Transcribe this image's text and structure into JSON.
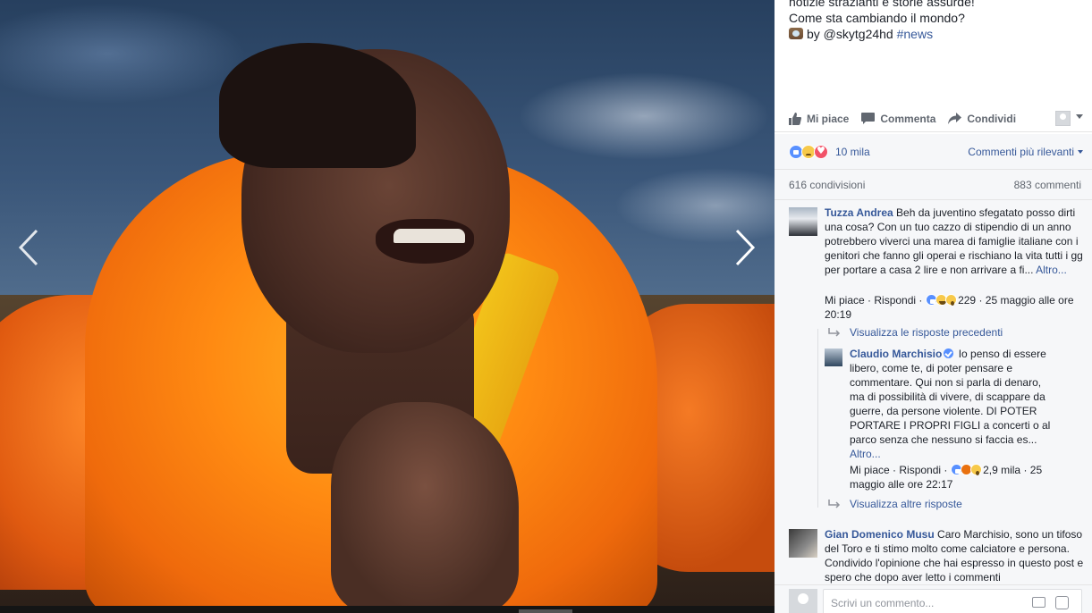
{
  "viewer": {
    "prev_glyph": "‹",
    "next_glyph": "›"
  },
  "post": {
    "caption_line1": "notizie strazianti e storie assurde!",
    "caption_line2": "Come sta cambiando il mondo?",
    "credit_prefix": "by @skytg24hd",
    "hashtag": "#news"
  },
  "actions": {
    "like": "Mi piace",
    "comment": "Commenta",
    "share": "Condividi"
  },
  "reactions": {
    "count": "10 mila",
    "sort_label": "Commenti più rilevanti"
  },
  "stats": {
    "shares": "616 condivisioni",
    "comments": "883 commenti"
  },
  "comments": [
    {
      "author": "Tuzza Andrea",
      "text": "Beh da juventino sfegatato posso dirti una cosa? Con un tuo cazzo di stipendio di un anno potrebbero viverci una marea di famiglie italiane con i genitori che fanno gli operai e rischiano la vita tutti i gg per portare a casa 2 lire e non arrivare a fi...",
      "more": "Altro...",
      "like": "Mi piace",
      "reply": "Rispondi",
      "reaction_count": "229",
      "date": "25 maggio alle ore 20:19",
      "prev_replies": "Visualizza le risposte precedenti"
    },
    {
      "author": "Claudio Marchisio",
      "text": "Io penso di essere libero, come te, di poter pensare e commentare. Qui non si parla di denaro, ma di possibilità di vivere, di scappare da guerre, da persone violente. DI POTER PORTARE I PROPRI FIGLI a concerti o al parco senza che nessuno si faccia es...",
      "more": "Altro...",
      "like": "Mi piace",
      "reply": "Rispondi",
      "reaction_count": "2,9 mila",
      "date": "25 maggio alle ore 22:17",
      "more_replies": "Visualizza altre risposte"
    },
    {
      "author": "Gian Domenico Musu",
      "text": "Caro Marchisio, sono un tifoso del Toro e ti stimo molto come calciatore e persona. Condivido l'opinione che hai espresso in questo post e spero che dopo aver letto i commenti"
    }
  ],
  "composer": {
    "placeholder": "Scrivi un commento..."
  }
}
